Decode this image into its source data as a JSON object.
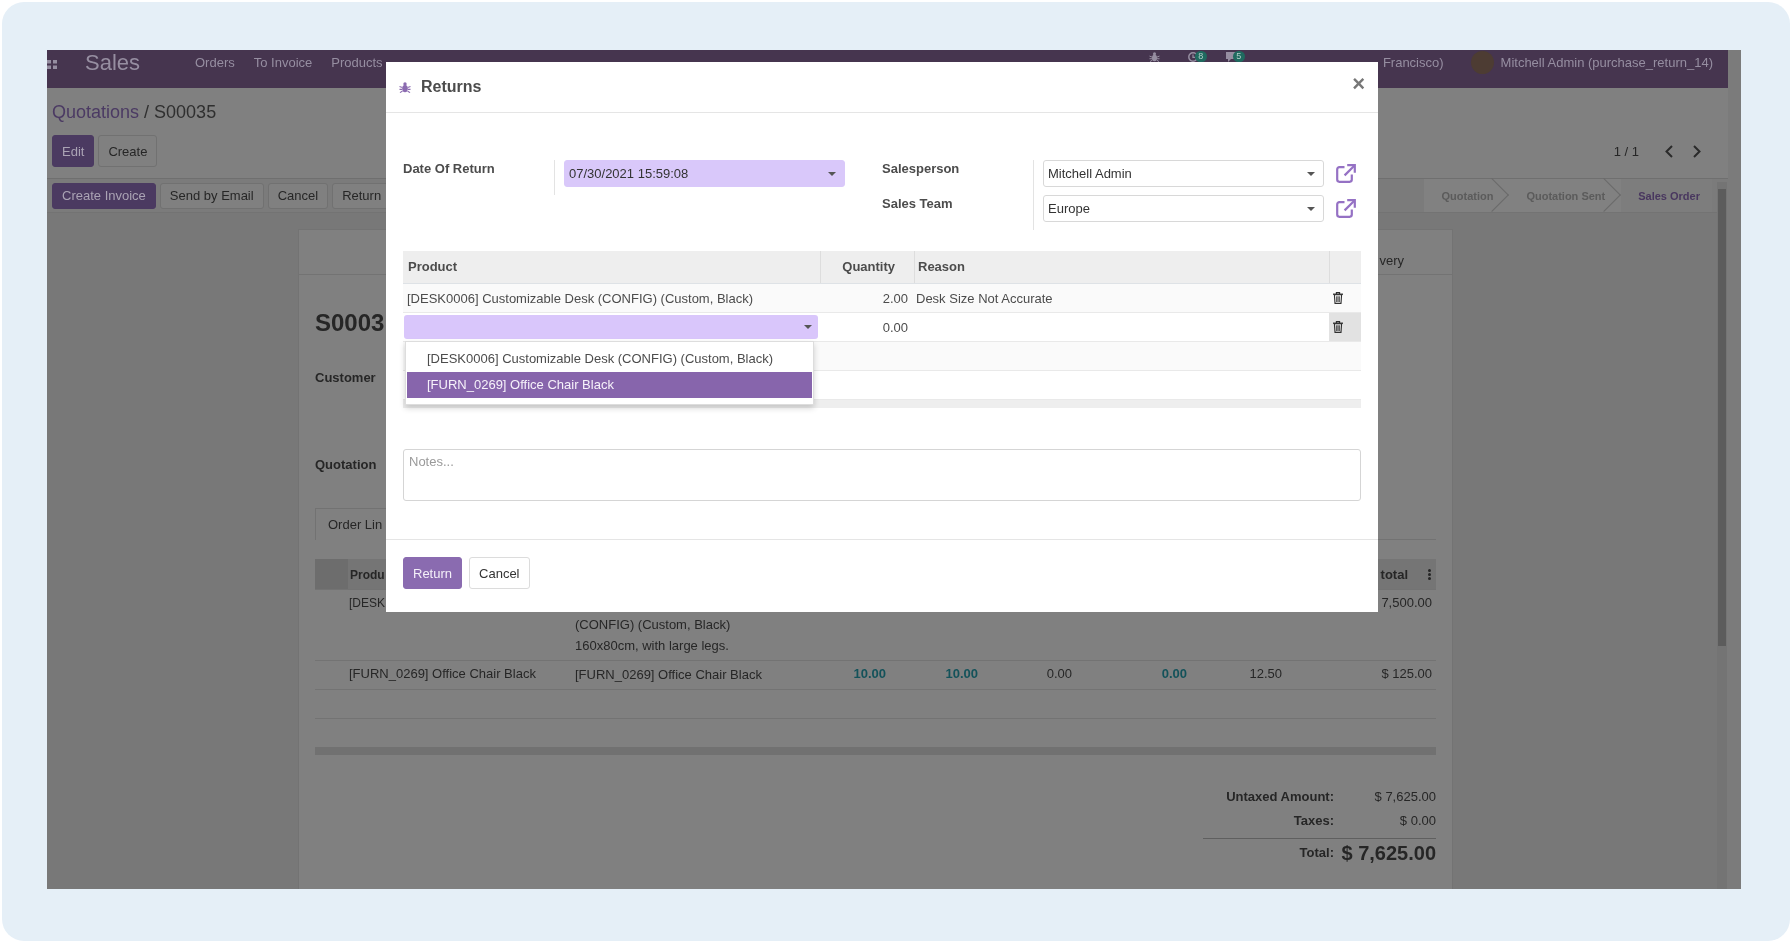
{
  "navbar": {
    "app_name": "Sales",
    "menu": [
      "Orders",
      "To Invoice",
      "Products"
    ],
    "systray": [
      {
        "kind": "debug"
      },
      {
        "kind": "activity",
        "badge": "8"
      },
      {
        "kind": "messages",
        "badge": "5"
      }
    ],
    "company": "Francisco)",
    "user": "Mitchell Admin (purchase_return_14)"
  },
  "breadcrumb": {
    "items": [
      "Quotations",
      "S00035"
    ],
    "separator": "/"
  },
  "control_buttons": [
    {
      "label": "Edit",
      "kind": "primary"
    },
    {
      "label": "Create",
      "kind": "secondary"
    }
  ],
  "pager": "1 / 1",
  "action_buttons": [
    {
      "label": "Create Invoice",
      "kind": "primary"
    },
    {
      "label": "Send by Email",
      "kind": "secondary"
    },
    {
      "label": "Cancel",
      "kind": "secondary"
    },
    {
      "label": "Return",
      "kind": "secondary"
    }
  ],
  "statusbar": [
    {
      "label": "Quotation",
      "selected": false
    },
    {
      "label": "Quotation Sent",
      "selected": false
    },
    {
      "label": "Sales Order",
      "selected": true
    }
  ],
  "sheet": {
    "smart_button": "very",
    "title": "S0003",
    "labels": [
      "Customer",
      "Quotation"
    ],
    "tab": {
      "label": "Order Lin",
      "selected": true
    },
    "order_lines": {
      "columns": [
        "Produ",
        "total"
      ],
      "rows": [
        {
          "product": "[DESK",
          "description": [
            "(CONFIG) (Custom, Black)",
            "160x80cm, with large legs."
          ],
          "subtotal": "7,500.00"
        },
        {
          "product": "[FURN_0269] Office Chair Black",
          "description": [
            "[FURN_0269] Office Chair Black"
          ],
          "quantities": [
            {
              "text": "10.00",
              "highlight": true
            },
            {
              "text": "10.00",
              "highlight": true
            },
            {
              "text": "0.00",
              "highlight": false
            },
            {
              "text": "0.00",
              "highlight": true
            },
            {
              "text": "12.50",
              "highlight": false
            }
          ],
          "subtotal": "$ 125.00"
        }
      ]
    },
    "totals": [
      {
        "label": "Untaxed Amount:",
        "value": "$ 7,625.00",
        "kind": "line"
      },
      {
        "label": "Taxes:",
        "value": "$ 0.00",
        "kind": "line"
      },
      {
        "label": "Total:",
        "value": "$ 7,625.00",
        "kind": "grand"
      }
    ]
  },
  "dialog": {
    "title": "Returns",
    "close": "×",
    "field_groups": [
      {
        "fields": [
          {
            "label": "Date Of Return",
            "value": "07/30/2021 15:59:08",
            "required": true
          }
        ]
      },
      {
        "fields": [
          {
            "label": "Salesperson",
            "value": "Mitchell Admin",
            "required": false,
            "external_link": true
          },
          {
            "label": "Sales Team",
            "value": "Europe",
            "required": false,
            "external_link": true
          }
        ]
      }
    ],
    "lines": {
      "columns": [
        "Product",
        "Quantity",
        "Reason"
      ],
      "rows": [
        {
          "product": "[DESK0006] Customizable Desk (CONFIG) (Custom, Black)",
          "quantity": "2.00",
          "reason": "Desk Size Not Accurate",
          "editing": false
        },
        {
          "quantity": "0.00",
          "editing": true
        }
      ],
      "dropdown": {
        "options": [
          {
            "label": "[DESK0006] Customizable Desk (CONFIG) (Custom, Black)",
            "selected": false
          },
          {
            "label": "[FURN_0269] Office Chair Black",
            "selected": true
          }
        ]
      }
    },
    "notes": {
      "placeholder": "Notes..."
    },
    "buttons": [
      {
        "label": "Return",
        "kind": "primary"
      },
      {
        "label": "Cancel",
        "kind": "secondary"
      }
    ]
  }
}
